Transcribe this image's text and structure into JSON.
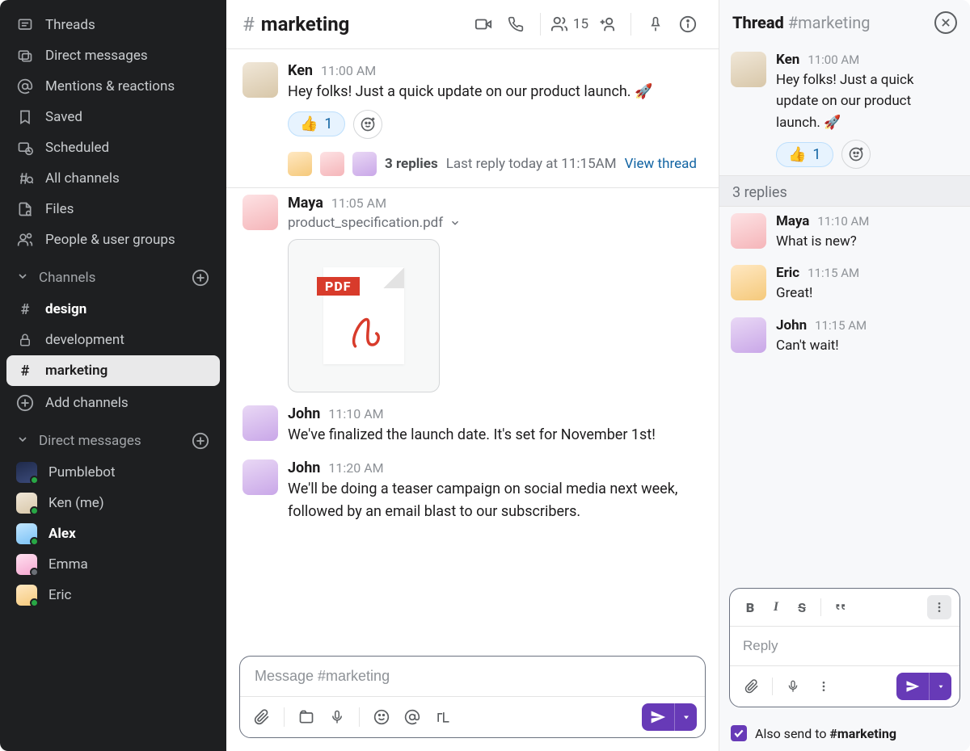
{
  "sidebar": {
    "nav": [
      {
        "icon": "threads",
        "label": "Threads"
      },
      {
        "icon": "dm",
        "label": "Direct messages"
      },
      {
        "icon": "mentions",
        "label": "Mentions & reactions"
      },
      {
        "icon": "saved",
        "label": "Saved"
      },
      {
        "icon": "scheduled",
        "label": "Scheduled"
      },
      {
        "icon": "allchan",
        "label": "All channels"
      },
      {
        "icon": "files",
        "label": "Files"
      },
      {
        "icon": "people",
        "label": "People & user groups"
      }
    ],
    "channels_header": "Channels",
    "channels": [
      {
        "name": "design",
        "icon": "hash",
        "bold": true,
        "active": false
      },
      {
        "name": "development",
        "icon": "lock",
        "bold": false,
        "active": false
      },
      {
        "name": "marketing",
        "icon": "hash",
        "bold": true,
        "active": true
      }
    ],
    "add_channels": "Add channels",
    "dms_header": "Direct messages",
    "dms": [
      {
        "name": "Pumblebot",
        "avatar": "av-bot",
        "online": true,
        "bold": false
      },
      {
        "name": "Ken (me)",
        "avatar": "av-ken",
        "online": true,
        "bold": false
      },
      {
        "name": "Alex",
        "avatar": "av-alex",
        "online": true,
        "bold": true
      },
      {
        "name": "Emma",
        "avatar": "av-emma",
        "online": false,
        "bold": false
      },
      {
        "name": "Eric",
        "avatar": "av-eric",
        "online": true,
        "bold": false
      }
    ]
  },
  "channel": {
    "name": "marketing",
    "member_count": "15"
  },
  "messages": [
    {
      "id": "m1",
      "author": "Ken",
      "avatar": "av-ken",
      "time": "11:00 AM",
      "text": "Hey folks! Just a quick update on our product launch. 🚀",
      "reaction_emoji": "👍",
      "reaction_count": "1",
      "thread": {
        "participants": [
          "av-eric",
          "av-maya",
          "av-john"
        ],
        "count": "3 replies",
        "last_reply": "Last reply today at 11:15AM",
        "view": "View thread"
      }
    },
    {
      "id": "m2",
      "author": "Maya",
      "avatar": "av-maya",
      "time": "11:05 AM",
      "attachment_name": "product_specification.pdf"
    },
    {
      "id": "m3",
      "author": "John",
      "avatar": "av-john",
      "time": "11:10 AM",
      "text": "We've finalized the launch date. It's set for November 1st!"
    },
    {
      "id": "m4",
      "author": "John",
      "avatar": "av-john",
      "time": "11:20 AM",
      "text": "We'll be doing a teaser campaign on social media next week, followed by an email blast to our subscribers."
    }
  ],
  "composer": {
    "placeholder": "Message #marketing"
  },
  "thread": {
    "title": "Thread",
    "channel": "#marketing",
    "root": {
      "author": "Ken",
      "avatar": "av-ken",
      "time": "11:00 AM",
      "text": "Hey folks! Just a quick update on our product launch. 🚀",
      "reaction_emoji": "👍",
      "reaction_count": "1"
    },
    "replies_label": "3 replies",
    "replies": [
      {
        "author": "Maya",
        "avatar": "av-maya",
        "time": "11:10 AM",
        "text": "What is new?"
      },
      {
        "author": "Eric",
        "avatar": "av-eric",
        "time": "11:15 AM",
        "text": "Great!"
      },
      {
        "author": "John",
        "avatar": "av-john",
        "time": "11:15 AM",
        "text": "Can't wait!"
      }
    ],
    "composer_placeholder": "Reply",
    "also_send_label": "Also send to ",
    "also_send_channel": "#marketing",
    "also_send_checked": true
  }
}
